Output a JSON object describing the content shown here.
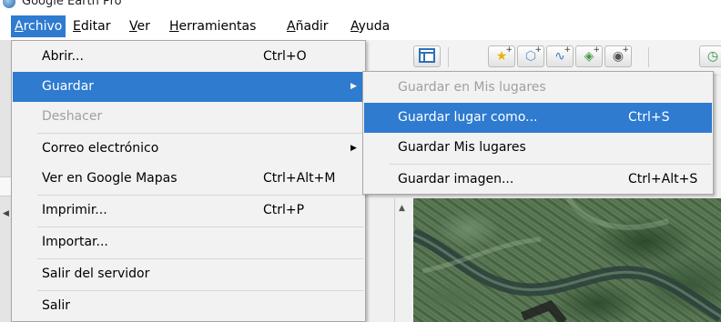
{
  "window": {
    "title": "Google Earth Pro"
  },
  "menubar": {
    "items": [
      {
        "label_acc": "A",
        "label_rest": "rchivo"
      },
      {
        "label_acc": "E",
        "label_rest": "ditar"
      },
      {
        "label_acc": "V",
        "label_rest": "er"
      },
      {
        "label_acc": "H",
        "label_rest": "erramientas"
      },
      {
        "label_acc": "A",
        "label_rest": "ñadir"
      },
      {
        "label_acc": "A",
        "label_rest": "yuda"
      }
    ]
  },
  "file_menu": {
    "items": [
      {
        "label": "Abrir...",
        "shortcut": "Ctrl+O"
      },
      {
        "label": "Guardar",
        "shortcut": ""
      },
      {
        "label": "Deshacer",
        "shortcut": ""
      },
      {
        "label": "Correo electrónico",
        "shortcut": ""
      },
      {
        "label": "Ver en Google Mapas",
        "shortcut": "Ctrl+Alt+M"
      },
      {
        "label": "Imprimir...",
        "shortcut": "Ctrl+P"
      },
      {
        "label": "Importar...",
        "shortcut": ""
      },
      {
        "label": "Salir del servidor",
        "shortcut": ""
      },
      {
        "label": "Salir",
        "shortcut": ""
      }
    ]
  },
  "save_submenu": {
    "items": [
      {
        "label": "Guardar en Mis lugares",
        "shortcut": ""
      },
      {
        "label": "Guardar lugar como...",
        "shortcut": "Ctrl+S"
      },
      {
        "label": "Guardar Mis lugares",
        "shortcut": ""
      },
      {
        "label": "Guardar imagen...",
        "shortcut": "Ctrl+Alt+S"
      }
    ]
  },
  "toolbar": {
    "icons": [
      "sidebar-toggle-icon",
      "add-placemark-icon",
      "add-polygon-icon",
      "add-path-icon",
      "add-overlay-icon",
      "record-tour-icon",
      "historical-imagery-icon"
    ]
  },
  "colors": {
    "highlight": "#2e7bd0",
    "menu_bg": "#f2f2f2",
    "disabled_text": "#a0a0a0"
  }
}
